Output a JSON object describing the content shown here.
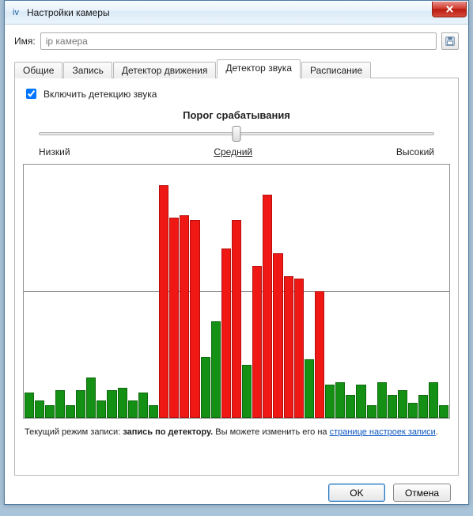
{
  "window": {
    "title": "Настройки камеры",
    "icon_text": "iv"
  },
  "name": {
    "label": "Имя:",
    "value": "ip камера"
  },
  "tabs": [
    {
      "label": "Общие"
    },
    {
      "label": "Запись"
    },
    {
      "label": "Детектор движения"
    },
    {
      "label": "Детектор звука"
    },
    {
      "label": "Расписание"
    }
  ],
  "detect": {
    "checkbox_label": "Включить детекцию звука",
    "checked": true,
    "threshold_title": "Порог срабатывания",
    "labels": {
      "low": "Низкий",
      "mid": "Средний",
      "high": "Высокий"
    },
    "slider_value": 50
  },
  "footer": {
    "prefix": "Текущий режим записи: ",
    "mode": "запись по детектору.",
    "middle": " Вы можете изменить его на ",
    "link": "странице настроек записи",
    "suffix": "."
  },
  "buttons": {
    "ok": "OK",
    "cancel": "Отмена"
  },
  "chart_data": {
    "type": "bar",
    "threshold": 50,
    "ylim": [
      0,
      100
    ],
    "categories_count": 41,
    "series": [
      {
        "name": "level",
        "values": [
          10,
          7,
          5,
          11,
          5,
          11,
          16,
          7,
          11,
          12,
          7,
          10,
          5,
          92,
          79,
          80,
          78,
          24,
          38,
          67,
          78,
          21,
          60,
          88,
          65,
          56,
          55,
          23,
          50,
          13,
          14,
          9,
          13,
          5,
          14,
          9,
          11,
          6,
          9,
          14,
          5
        ]
      }
    ],
    "bar_color_rule": "red if value >= threshold else green",
    "xlabel": "",
    "ylabel": ""
  }
}
